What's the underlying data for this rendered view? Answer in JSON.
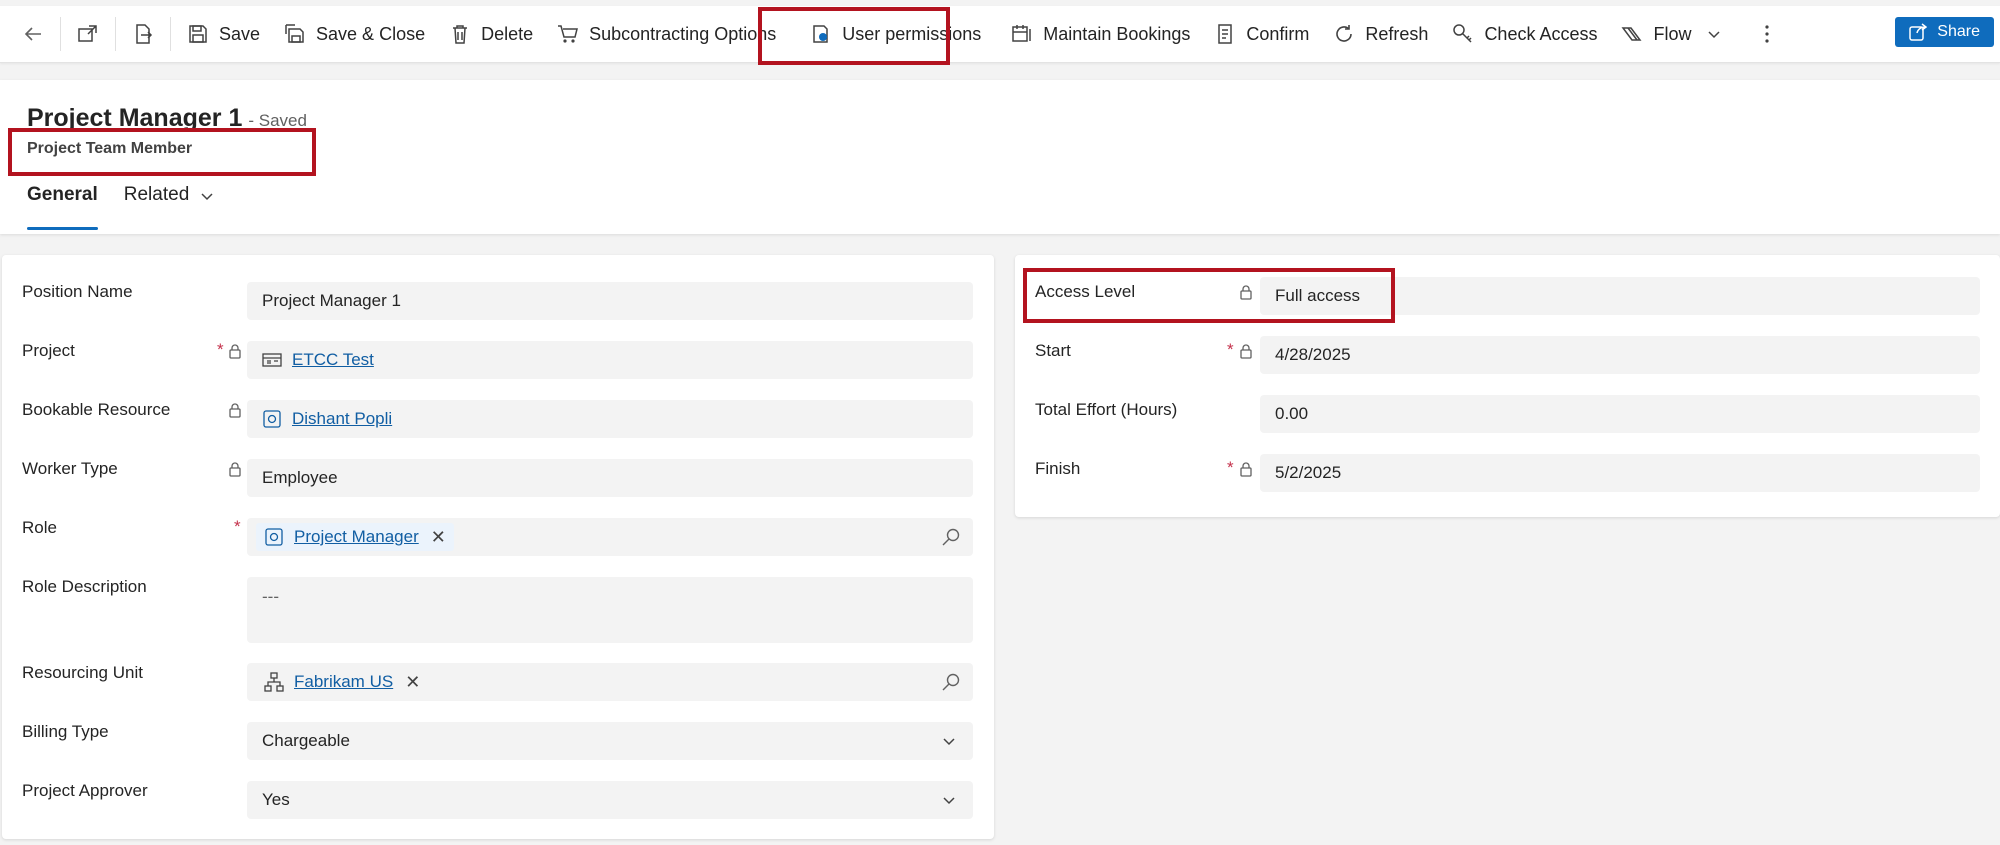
{
  "toolbar": {
    "save": "Save",
    "save_close": "Save & Close",
    "delete": "Delete",
    "subcontracting": "Subcontracting Options",
    "user_permissions": "User permissions",
    "maintain_bookings": "Maintain Bookings",
    "confirm": "Confirm",
    "refresh": "Refresh",
    "check_access": "Check Access",
    "flow": "Flow",
    "share": "Share"
  },
  "header": {
    "title": "Project Manager 1",
    "saved": "- Saved",
    "subtitle": "Project Team Member",
    "tabs": [
      {
        "label": "General"
      },
      {
        "label": "Related"
      }
    ]
  },
  "left_fields": [
    {
      "label": "Position Name",
      "value": "Project Manager 1"
    },
    {
      "label": "Project",
      "value": "ETCC Test",
      "required": "*"
    },
    {
      "label": "Bookable Resource",
      "value": "Dishant Popli"
    },
    {
      "label": "Worker Type",
      "value": "Employee"
    },
    {
      "label": "Role",
      "value": "Project Manager",
      "required": "*",
      "remove": "✕"
    },
    {
      "label": "Role Description",
      "value": "---"
    },
    {
      "label": "Resourcing Unit",
      "value": "Fabrikam US",
      "remove": "✕"
    },
    {
      "label": "Billing Type",
      "value": "Chargeable"
    },
    {
      "label": "Project Approver",
      "value": "Yes"
    }
  ],
  "right_fields": [
    {
      "label": "Access Level",
      "value": "Full access"
    },
    {
      "label": "Start",
      "value": "4/28/2025",
      "required": "*"
    },
    {
      "label": "Total Effort (Hours)",
      "value": "0.00"
    },
    {
      "label": "Finish",
      "value": "5/2/2025",
      "required": "*"
    }
  ],
  "colors": {
    "accent": "#0f6cbd",
    "highlight": "#b3131f",
    "required": "#c4314b",
    "link": "#115ea3"
  }
}
